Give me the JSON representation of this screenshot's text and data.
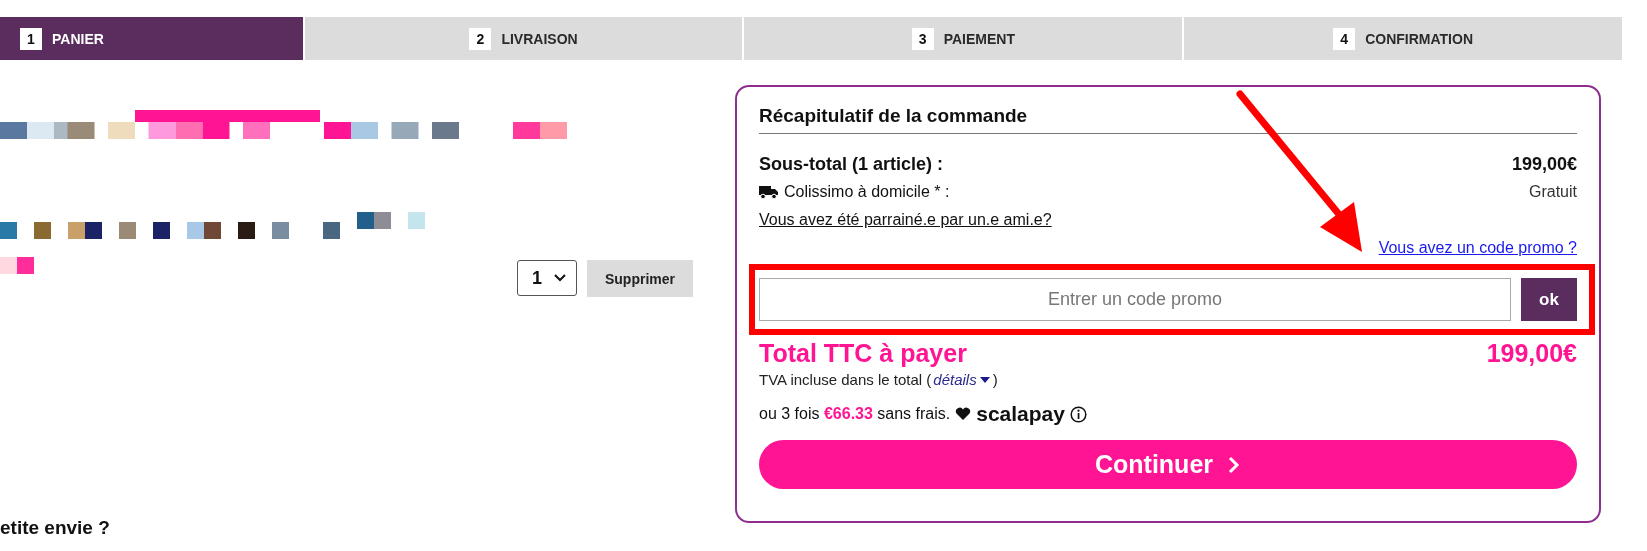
{
  "steps": [
    {
      "number": "1",
      "label": "PANIER",
      "selected": true
    },
    {
      "number": "2",
      "label": "LIVRAISON",
      "selected": false
    },
    {
      "number": "3",
      "label": "PAIEMENT",
      "selected": false
    },
    {
      "number": "4",
      "label": "CONFIRMATION",
      "selected": false
    }
  ],
  "cart_item": {
    "quantity": "1",
    "remove_button": "Supprimer"
  },
  "suggestion_heading": "etite envie ?",
  "summary": {
    "title": "Récapitulatif de la commande",
    "subtotal_label": "Sous-total (1 article) :",
    "subtotal_value": "199,00€",
    "shipping_label": "Colissimo à domicile * :",
    "shipping_value": "Gratuit",
    "referral_link": "Vous avez été parrainé.e par un.e ami.e?",
    "promo_link": "Vous avez un code promo ?",
    "promo_placeholder": "Entrer un code promo",
    "promo_button": "ok",
    "total_label": "Total TTC à payer",
    "total_value": "199,00€",
    "vat_note": "TVA incluse dans le total (",
    "vat_details": "détails",
    "vat_close": ")",
    "installment": "ou 3 fois **€66.33** sans frais.",
    "scalapay_logo": "scalapay",
    "continue_button": "Continuer"
  }
}
